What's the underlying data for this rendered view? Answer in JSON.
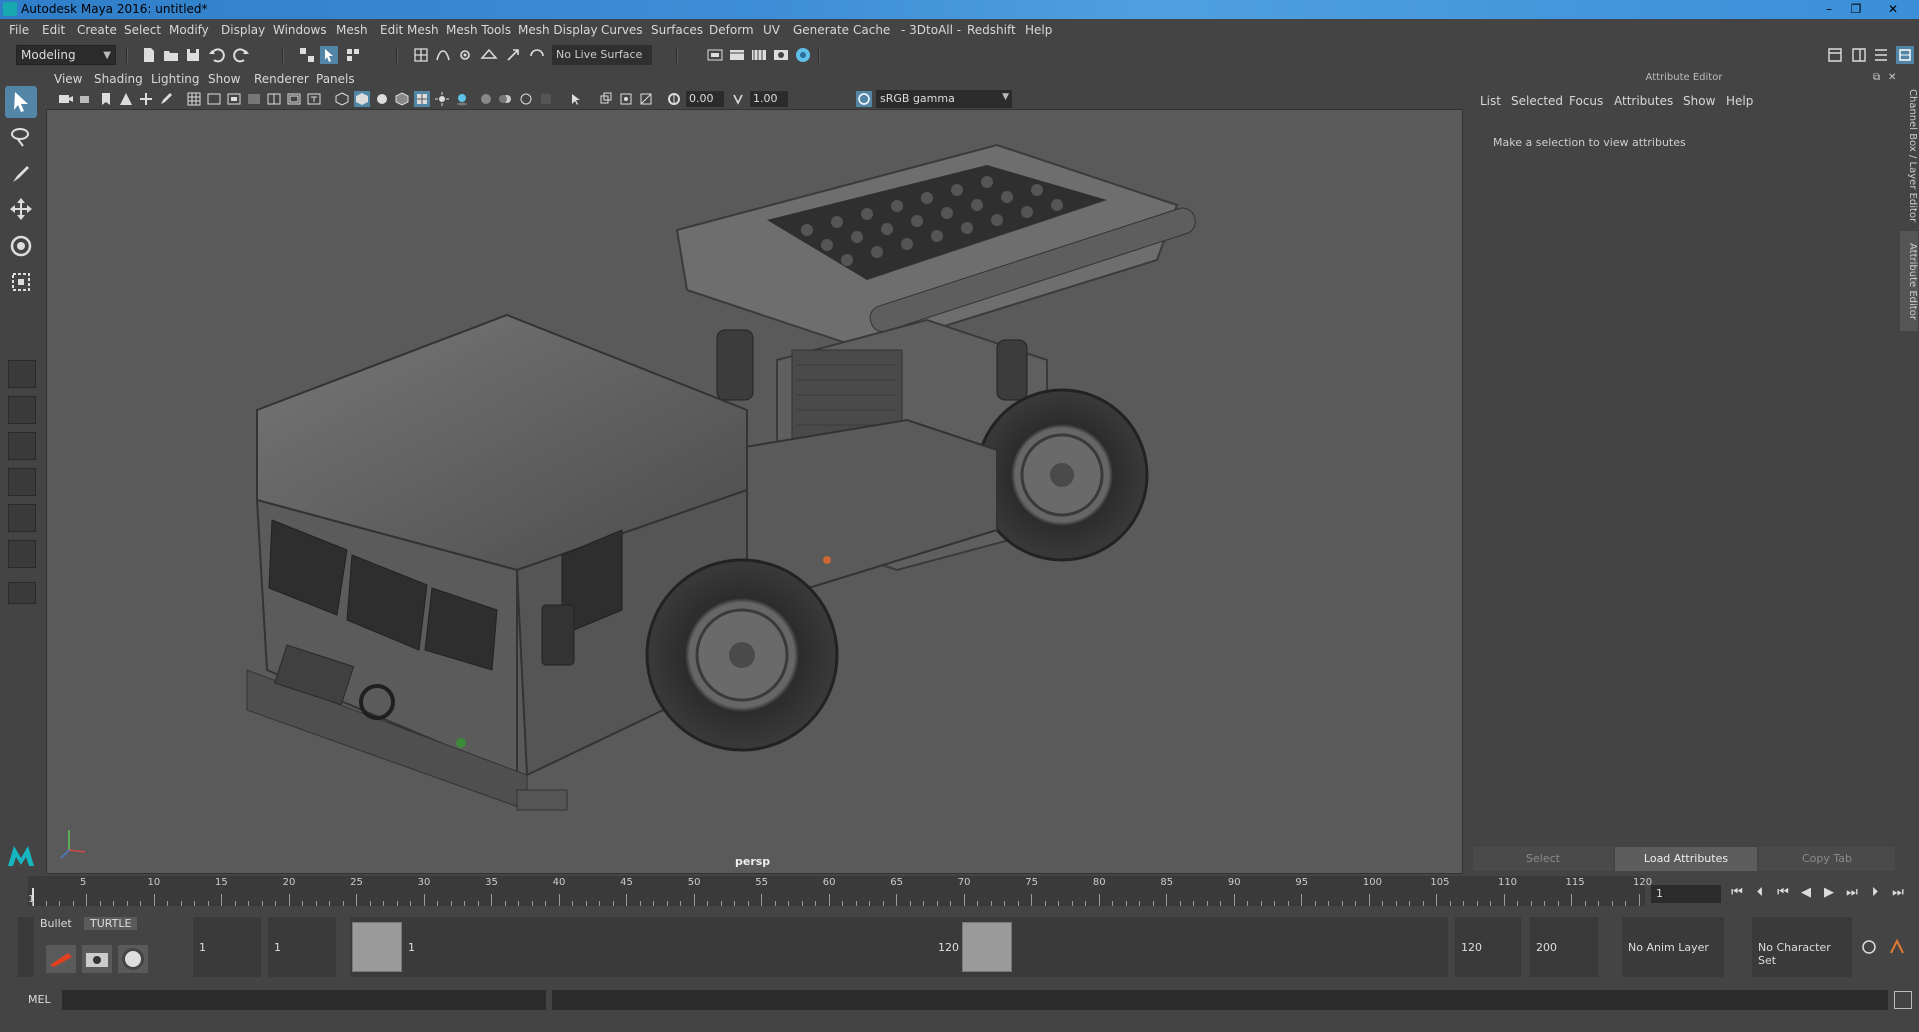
{
  "window": {
    "title": "Autodesk Maya 2016: untitled*",
    "minimize": "–",
    "maximize": "❐",
    "close": "✕"
  },
  "menubar": {
    "items": [
      "File",
      "Edit",
      "Create",
      "Select",
      "Modify",
      "Display",
      "Windows",
      "Mesh",
      "Edit Mesh",
      "Mesh Tools",
      "Mesh Display",
      "Curves",
      "Surfaces",
      "Deform",
      "UV",
      "Generate",
      "Cache",
      "- 3DtoAll -",
      "Redshift",
      "Help"
    ]
  },
  "statusline": {
    "mode": "Modeling",
    "live_surface": "No Live Surface"
  },
  "viewport": {
    "menu": [
      "View",
      "Shading",
      "Lighting",
      "Show",
      "Renderer",
      "Panels"
    ],
    "exposure": "0.00",
    "gamma": "1.00",
    "color_space": "sRGB gamma",
    "camera": "persp"
  },
  "attribute_editor": {
    "title": "Attribute Editor",
    "menu": [
      "List",
      "Selected",
      "Focus",
      "Attributes",
      "Show",
      "Help"
    ],
    "message": "Make a selection to view attributes",
    "buttons": {
      "select": "Select",
      "load": "Load Attributes",
      "copy": "Copy Tab"
    },
    "side_tabs": [
      "Channel Box / Layer Editor",
      "Attribute Editor"
    ]
  },
  "timeslider": {
    "ticks": [
      "5",
      "10",
      "15",
      "20",
      "25",
      "30",
      "35",
      "40",
      "45",
      "50",
      "55",
      "60",
      "65",
      "70",
      "75",
      "80",
      "85",
      "90",
      "95",
      "100",
      "105",
      "110",
      "115",
      "120"
    ],
    "start_label": "1",
    "current_frame": "1"
  },
  "range": {
    "shelf_tabs": [
      "Bullet",
      "TURTLE"
    ],
    "start": "1",
    "playback_start": "1",
    "handle_start": "1",
    "handle_end": "120",
    "playback_end": "120",
    "end": "200",
    "anim_layer": "No Anim Layer",
    "character_set": "No Character Set"
  },
  "cmdline": {
    "label": "MEL"
  }
}
